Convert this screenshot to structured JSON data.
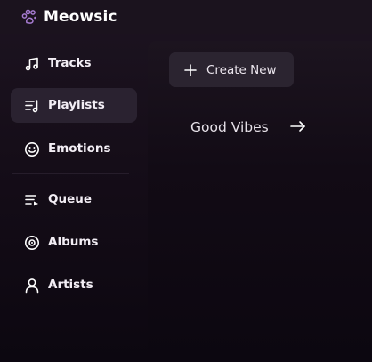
{
  "app": {
    "title": "Meowsic",
    "logo_icon": "paw-icon",
    "accent": "#a67bd1"
  },
  "sidebar": {
    "items": [
      {
        "label": "Tracks",
        "icon": "music-note-icon",
        "active": false
      },
      {
        "label": "Playlists",
        "icon": "playlist-icon",
        "active": true
      },
      {
        "label": "Emotions",
        "icon": "smiley-icon",
        "active": false
      },
      {
        "label": "Queue",
        "icon": "queue-icon",
        "active": false
      },
      {
        "label": "Albums",
        "icon": "disc-icon",
        "active": false
      },
      {
        "label": "Artists",
        "icon": "person-icon",
        "active": false
      }
    ]
  },
  "main": {
    "create_button": {
      "label": "Create New",
      "icon": "plus-icon"
    },
    "playlists": [
      {
        "name": "Good Vibes",
        "icon": "arrow-right-icon"
      }
    ]
  }
}
